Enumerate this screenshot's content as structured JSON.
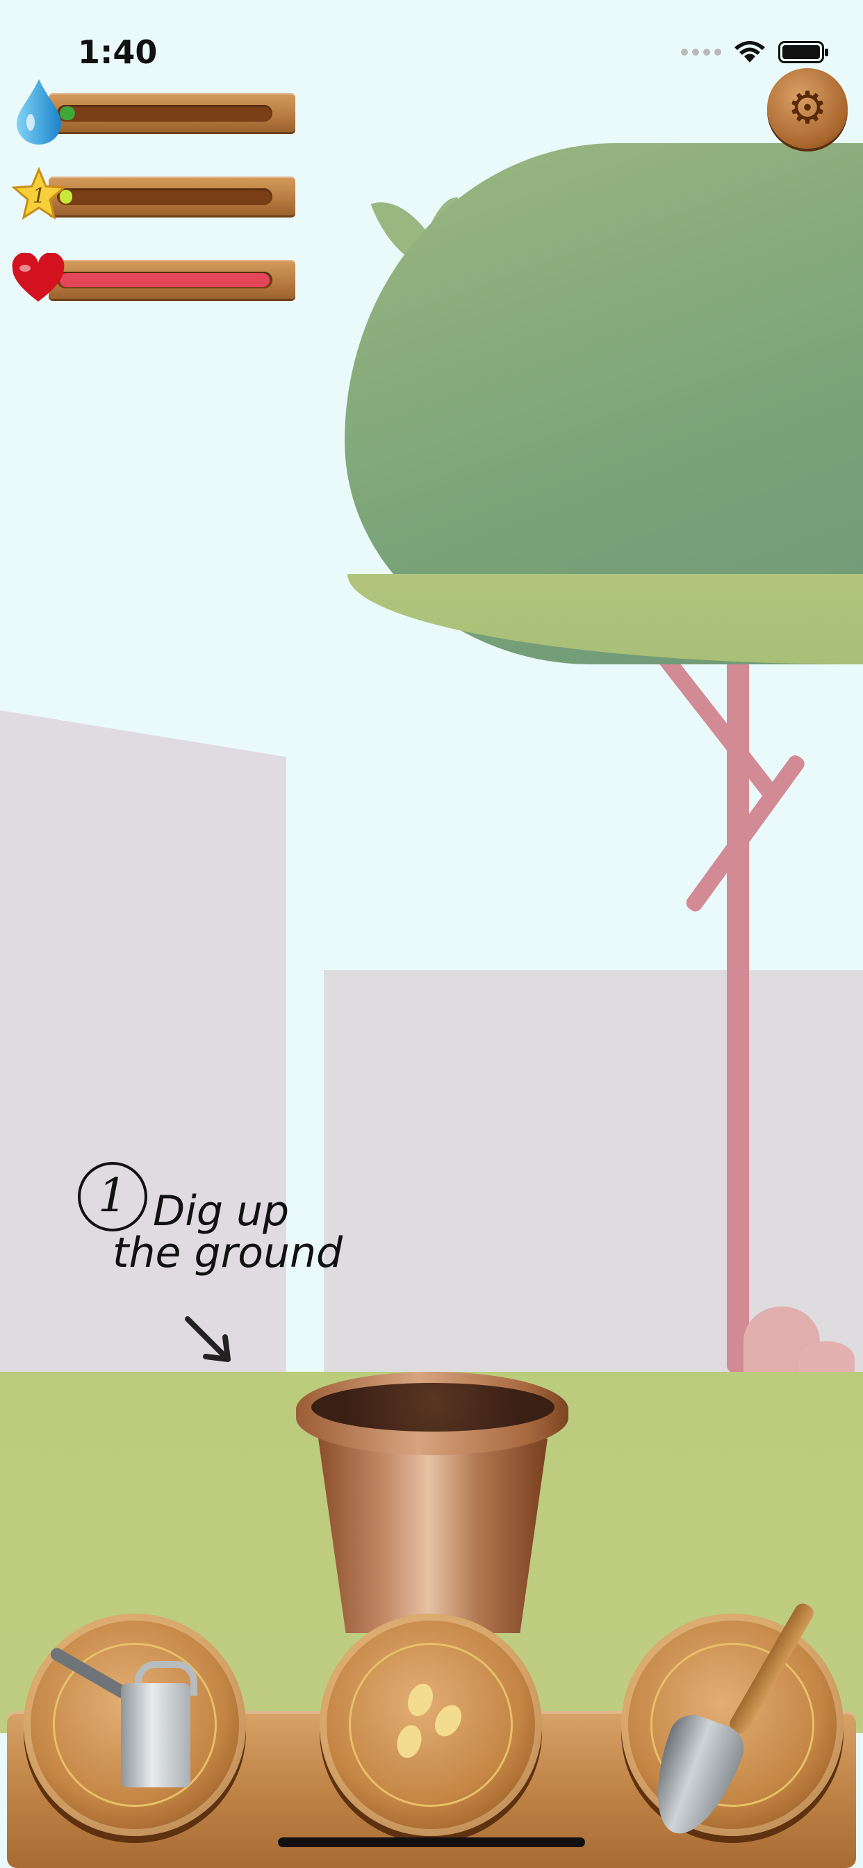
{
  "status_bar": {
    "time": "1:40"
  },
  "stats": {
    "water": {
      "icon": "water-drop-icon",
      "fill_color": "#3fa73a",
      "level": 0.07
    },
    "level": {
      "icon": "star-level-icon",
      "badge": "1",
      "fill_color": "#c8e83a",
      "level": 0.03
    },
    "health": {
      "icon": "heart-icon",
      "fill_color": "#e4475a",
      "level": 1.0
    }
  },
  "settings": {
    "icon": "gear-icon"
  },
  "tutorial": {
    "step": "1",
    "line1": "Dig up",
    "line2": "the ground",
    "arrow": "↓"
  },
  "tools": [
    {
      "name": "watering-can",
      "icon": "watering-can-icon"
    },
    {
      "name": "seeds",
      "icon": "seeds-icon"
    },
    {
      "name": "shovel",
      "icon": "shovel-icon"
    }
  ],
  "colors": {
    "sky": "#eafafa",
    "grass": "#bccc7d",
    "canopy": "#8fb17d",
    "trunk": "#d28a95"
  }
}
